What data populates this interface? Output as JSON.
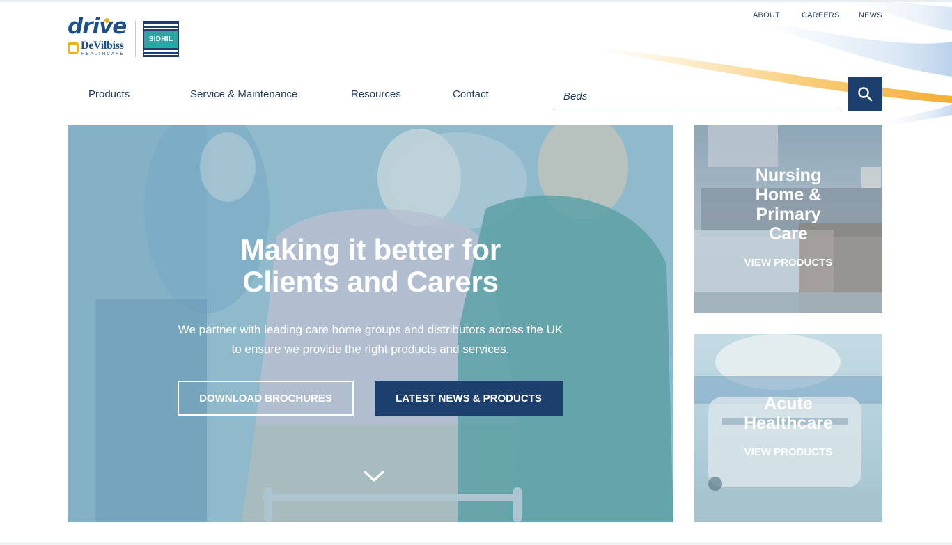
{
  "brand": {
    "logo_text": "drive",
    "sublogo_text": "DeVilbiss",
    "sublogo_tagline": "HEALTHCARE",
    "partner_logo_text": "SIDHIL"
  },
  "utility_nav": {
    "about": "ABOUT",
    "careers": "CAREERS",
    "news": "NEWS"
  },
  "main_nav": {
    "items": [
      {
        "label": "Products"
      },
      {
        "label": "Service & Maintenance"
      },
      {
        "label": "Resources"
      },
      {
        "label": "Contact"
      }
    ]
  },
  "search": {
    "value": "Beds",
    "icon": "search-icon"
  },
  "hero": {
    "title_line1": "Making it better for",
    "title_line2": "Clients and Carers",
    "subtitle_line1": "We partner with leading care home groups and distributors across the UK",
    "subtitle_line2": "to ensure we provide the right products and services.",
    "btn_download": "DOWNLOAD BROCHURES",
    "btn_news": "LATEST NEWS & PRODUCTS",
    "scroll_icon": "chevron-down-icon"
  },
  "cards": [
    {
      "title_lines": [
        "Nursing",
        "Home &",
        "Primary",
        "Care"
      ],
      "link": "VIEW PRODUCTS"
    },
    {
      "title_lines": [
        "Acute",
        "Healthcare"
      ],
      "link": "VIEW PRODUCTS"
    }
  ],
  "colors": {
    "navy": "#1c3f6e",
    "brand_blue": "#1e4f86",
    "teal": "#2aa6a5",
    "accent_yellow": "#f2b21b",
    "text": "#1f3a5f"
  }
}
